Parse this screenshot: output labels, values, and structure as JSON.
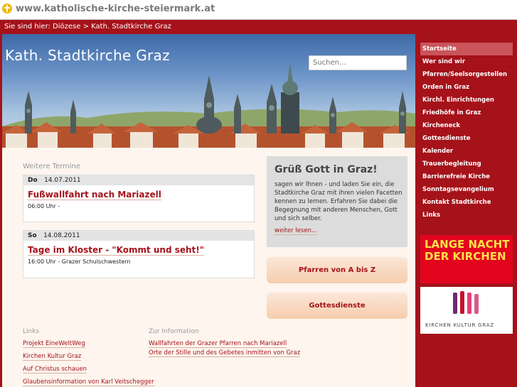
{
  "browser": {
    "url": "www.katholische-kirche-steiermark.at"
  },
  "breadcrumb": "Sie sind hier: Diözese > Kath. Stadtkirche Graz",
  "hero": {
    "title": "Kath. Stadtkirche Graz",
    "search_placeholder": "Suchen..."
  },
  "events": {
    "heading": "Weitere Termine",
    "items": [
      {
        "day": "Do",
        "date": "14.07.2011",
        "title": "Fußwallfahrt nach Mariazell",
        "info": "06:00 Uhr -"
      },
      {
        "day": "So",
        "date": "14.08.2011",
        "title": "Tage im Kloster - \"Kommt und seht!\"",
        "info": "16:00 Uhr - Grazer Schulschwestern"
      }
    ]
  },
  "greeting": {
    "title": "Grüß Gott in Graz!",
    "text": "sagen wir Ihnen - und laden Sie ein, die Stadtkirche Graz mit ihren vielen Facetten kennen zu lernen. Erfahren Sie dabei die Begegnung mit anderen Menschen, Gott und sich selber.",
    "more": "weiter lesen..."
  },
  "buttons": {
    "pfarren": "Pfarren von A bis Z",
    "gottesdienste": "Gottesdienste"
  },
  "links": {
    "heading": "Links",
    "items": [
      "Projekt EineWeltWeg",
      "Kirchen Kultur Graz",
      "Auf Christus schauen",
      "Glaubensinformation von Karl Veitschegger"
    ]
  },
  "info": {
    "heading": "Zur Information",
    "items": [
      "Wallfahrten der Grazer Pfarren nach Mariazell",
      "Orte der Stille und des Gebetes inmitten von Graz"
    ]
  },
  "nav": {
    "active_index": 0,
    "items": [
      "Startseite",
      "Wer sind wir",
      "Pfarren/Seelsorgestellen",
      "Orden in Graz",
      "Kirchl. Einrichtungen",
      "Friedhöfe in Graz",
      "Kircheneck",
      "Gottesdienste",
      "Kalender",
      "Trauerbegleitung",
      "Barrierefreie Kirche",
      "Sonntagsevangelium",
      "Kontakt Stadtkirche",
      "Links"
    ]
  },
  "promos": {
    "lange_nacht": "LANGE NACHT DER KIRCHEN",
    "kirchen_kultur": "KIRCHEN KULTUR GRAZ"
  },
  "colors": {
    "brand_red": "#a5121a",
    "lange_nacht_bg": "#e3051e",
    "lange_nacht_text": "#fde14a"
  }
}
